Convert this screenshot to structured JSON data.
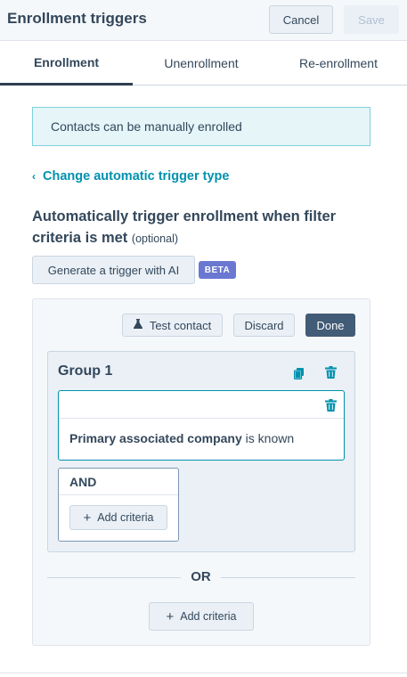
{
  "header": {
    "title": "Enrollment triggers",
    "cancel_label": "Cancel",
    "save_label": "Save"
  },
  "tabs": [
    {
      "label": "Enrollment",
      "active": true
    },
    {
      "label": "Unenrollment",
      "active": false
    },
    {
      "label": "Re-enrollment",
      "active": false
    }
  ],
  "alert": {
    "text": "Contacts can be manually enrolled"
  },
  "back_link": {
    "label": "Change automatic trigger type",
    "icon": "chevron-left-icon"
  },
  "section": {
    "heading": "Automatically trigger enrollment when filter criteria is met",
    "optional": "(optional)",
    "generate_ai_label": "Generate a trigger with AI",
    "beta_badge": "BETA"
  },
  "filter_panel": {
    "test_contact_label": "Test contact",
    "discard_label": "Discard",
    "done_label": "Done",
    "group": {
      "title": "Group 1",
      "filter": {
        "property": "Primary associated company",
        "condition": "is known"
      },
      "and_label": "AND",
      "add_criteria_label": "Add criteria"
    },
    "or_label": "OR",
    "add_criteria_label": "Add criteria"
  },
  "colors": {
    "accent_link": "#0091ae",
    "done_button": "#425b76",
    "beta_badge": "#6a78d1",
    "alert_bg": "#e5f5f8",
    "alert_border": "#7fd1de",
    "text": "#33475b"
  }
}
